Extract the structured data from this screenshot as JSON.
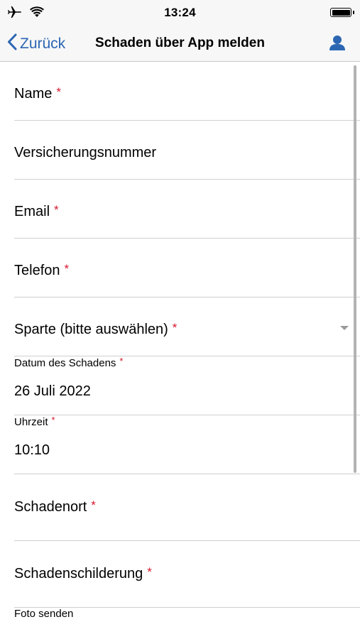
{
  "status_bar": {
    "time": "13:24",
    "icons": [
      "airplane-icon",
      "wifi-icon",
      "battery-icon"
    ]
  },
  "nav": {
    "back_label": "Zurück",
    "title": "Schaden über App melden",
    "user_icon": "user-icon",
    "accent_color": "#2c66b3"
  },
  "form": {
    "required_marker": "*",
    "required_color": "#d7172f",
    "name": {
      "label": "Name",
      "required": true,
      "value": ""
    },
    "policy_number": {
      "label": "Versicherungsnummer",
      "required": false,
      "value": ""
    },
    "email": {
      "label": "Email",
      "required": true,
      "value": ""
    },
    "phone": {
      "label": "Telefon",
      "required": true,
      "value": ""
    },
    "category": {
      "label": "Sparte (bitte auswählen)",
      "required": true,
      "value": ""
    },
    "damage_date": {
      "label": "Datum des Schadens",
      "required": true,
      "value": "26 Juli 2022"
    },
    "time": {
      "label": "Uhrzeit",
      "required": true,
      "value": "10:10"
    },
    "location": {
      "label": "Schadenort",
      "required": true,
      "value": ""
    },
    "description": {
      "label": "Schadenschilderung",
      "required": true,
      "value": ""
    },
    "photo": {
      "label": "Foto senden"
    }
  }
}
